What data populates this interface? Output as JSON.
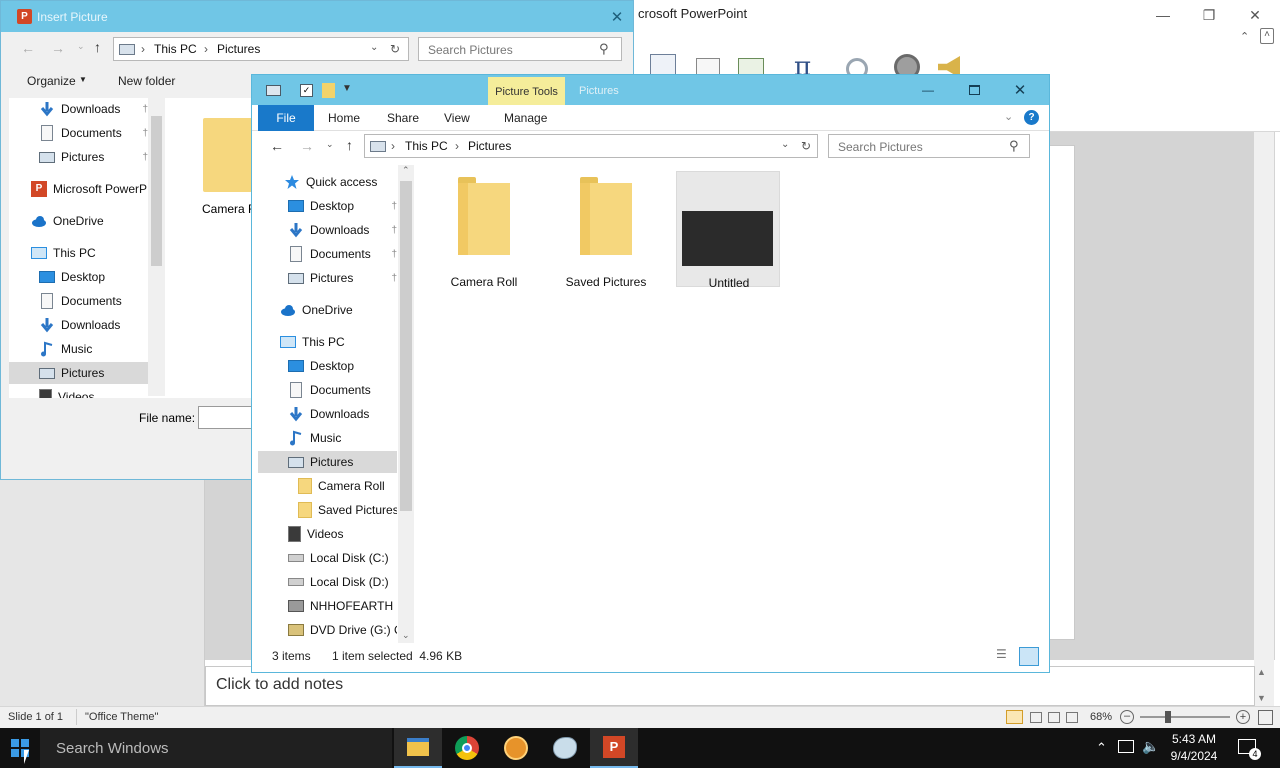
{
  "powerpoint": {
    "title": "crosoft PowerPoint",
    "notes_placeholder": "Click to add notes",
    "status": {
      "slide": "Slide 1 of 1",
      "theme": "\"Office Theme\"",
      "zoom": "68%"
    }
  },
  "insert_dialog": {
    "title": "Insert Picture",
    "breadcrumb": [
      "This PC",
      "Pictures"
    ],
    "search_placeholder": "Search Pictures",
    "toolbar": {
      "organize": "Organize",
      "new_folder": "New folder"
    },
    "nav_items": [
      {
        "label": "Downloads",
        "icon": "downloads-icon",
        "pinned": true
      },
      {
        "label": "Documents",
        "icon": "documents-icon",
        "pinned": true
      },
      {
        "label": "Pictures",
        "icon": "pictures-icon",
        "pinned": true
      },
      {
        "label": "Microsoft PowerP",
        "icon": "powerpoint-icon"
      },
      {
        "label": "OneDrive",
        "icon": "onedrive-icon"
      },
      {
        "label": "This PC",
        "icon": "this-pc-icon"
      },
      {
        "label": "Desktop",
        "icon": "desktop-icon"
      },
      {
        "label": "Documents",
        "icon": "documents-icon"
      },
      {
        "label": "Downloads",
        "icon": "downloads-icon"
      },
      {
        "label": "Music",
        "icon": "music-icon"
      },
      {
        "label": "Pictures",
        "icon": "pictures-icon",
        "selected": true
      },
      {
        "label": "Videos",
        "icon": "videos-icon"
      }
    ],
    "items": [
      {
        "label": "Camera R"
      }
    ],
    "file_name_label": "File name:",
    "file_name_value": ""
  },
  "explorer": {
    "contextual_tab_group": "Picture Tools",
    "faded_title": "Pictures",
    "tabs": {
      "file": "File",
      "home": "Home",
      "share": "Share",
      "view": "View",
      "manage": "Manage"
    },
    "breadcrumb": [
      "This PC",
      "Pictures"
    ],
    "search_placeholder": "Search Pictures",
    "nav_items": [
      {
        "label": "Quick access",
        "icon": "star-icon"
      },
      {
        "label": "Desktop",
        "icon": "desktop-icon",
        "pinned": true
      },
      {
        "label": "Downloads",
        "icon": "downloads-icon",
        "pinned": true
      },
      {
        "label": "Documents",
        "icon": "documents-icon",
        "pinned": true
      },
      {
        "label": "Pictures",
        "icon": "pictures-icon",
        "pinned": true
      },
      {
        "label": "OneDrive",
        "icon": "onedrive-icon"
      },
      {
        "label": "This PC",
        "icon": "this-pc-icon"
      },
      {
        "label": "Desktop",
        "icon": "desktop-icon"
      },
      {
        "label": "Documents",
        "icon": "documents-icon"
      },
      {
        "label": "Downloads",
        "icon": "downloads-icon"
      },
      {
        "label": "Music",
        "icon": "music-icon"
      },
      {
        "label": "Pictures",
        "icon": "pictures-icon",
        "selected": true
      },
      {
        "label": "Camera Roll",
        "icon": "folder-icon"
      },
      {
        "label": "Saved Pictures",
        "icon": "folder-icon"
      },
      {
        "label": "Videos",
        "icon": "videos-icon"
      },
      {
        "label": "Local Disk (C:)",
        "icon": "disk-icon"
      },
      {
        "label": "Local Disk (D:)",
        "icon": "disk-icon"
      },
      {
        "label": "NHHOFEARTH (",
        "icon": "network-drive-icon"
      },
      {
        "label": "DVD Drive (G:) O",
        "icon": "dvd-icon"
      }
    ],
    "files": [
      {
        "name": "Camera Roll",
        "type": "folder"
      },
      {
        "name": "Saved Pictures",
        "type": "folder"
      },
      {
        "name": "Untitled",
        "type": "image",
        "selected": true
      }
    ],
    "status": {
      "count": "3 items",
      "selection": "1 item selected  4.96 KB"
    }
  },
  "taskbar": {
    "search_placeholder": "Search Windows",
    "time": "5:43 AM",
    "date": "9/4/2024",
    "notification_count": "4"
  }
}
